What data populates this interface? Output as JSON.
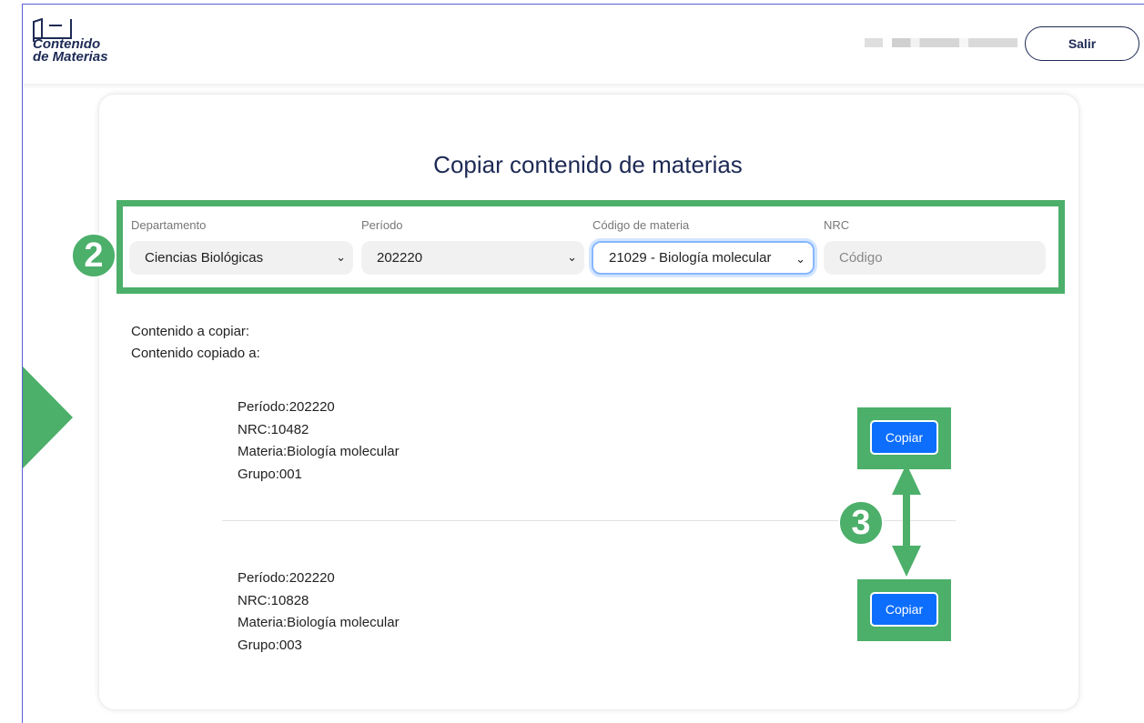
{
  "header": {
    "logo_line1": "Contenido",
    "logo_line2": "de Materias",
    "logout_label": "Salir"
  },
  "page": {
    "title": "Copiar contenido de materias"
  },
  "filters": {
    "department": {
      "label": "Departamento",
      "value": "Ciencias Biológicas"
    },
    "period": {
      "label": "Período",
      "value": "202220"
    },
    "subject_code": {
      "label": "Código de materia",
      "value": "21029 - Biología molecular"
    },
    "nrc": {
      "label": "NRC",
      "placeholder": "Código"
    }
  },
  "summary": {
    "content_to_copy": "Contenido a copiar:",
    "content_copied_to": "Contenido copiado a:"
  },
  "records": [
    {
      "period": "Período:202220",
      "nrc": "NRC:10482",
      "subject": "Materia:Biología molecular",
      "group": "Grupo:001",
      "button_label": "Copiar"
    },
    {
      "period": "Período:202220",
      "nrc": "NRC:10828",
      "subject": "Materia:Biología molecular",
      "group": "Grupo:003",
      "button_label": "Copiar"
    }
  ],
  "annotations": {
    "badge_2": "2",
    "badge_3": "3"
  },
  "colors": {
    "accent_green": "#4caf6a",
    "primary_blue": "#0d6efd",
    "navy": "#1d2a55"
  }
}
